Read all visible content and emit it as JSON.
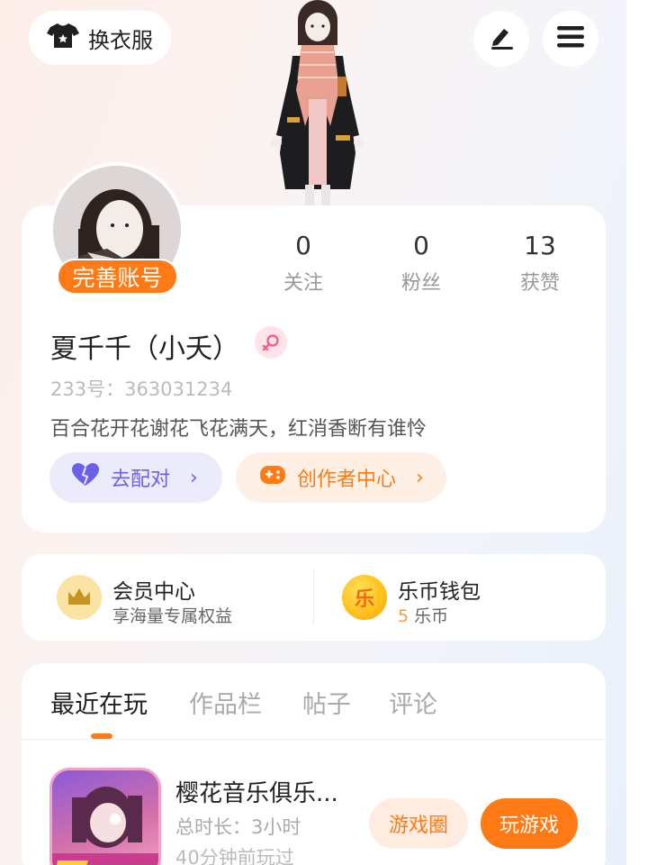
{
  "header": {
    "outfit_label": "换衣服",
    "outfit_icon": "tshirt-icon",
    "edit_icon": "pen-icon",
    "menu_icon": "hamburger-menu-icon"
  },
  "profile": {
    "complete_account_label": "完善账号",
    "stats": [
      {
        "value": "0",
        "label": "关注"
      },
      {
        "value": "0",
        "label": "粉丝"
      },
      {
        "value": "13",
        "label": "获赞"
      }
    ],
    "name": "夏千千（小夭）",
    "gender_icon": "female-icon",
    "uid": "233号：363031234",
    "bio": "百合花开花谢花飞花满天，红消香断有谁怜",
    "match_label": "去配对",
    "creator_label": "创作者中心"
  },
  "member": {
    "vip_title": "会员中心",
    "vip_subtitle": "享海量专属权益",
    "vip_icon": "crown-icon",
    "wallet_title": "乐币钱包",
    "wallet_coins": "5",
    "wallet_unit": "乐币",
    "wallet_icon_char": "乐"
  },
  "tabs": [
    "最近在玩",
    "作品栏",
    "帖子",
    "评论"
  ],
  "game": {
    "title": "樱花音乐俱乐...",
    "duration": "总时长：3小时",
    "last_played": "40分钟前玩过",
    "circle_label": "游戏圈",
    "play_label": "玩游戏"
  },
  "colors": {
    "accent": "#ff7a14",
    "match": "#6b60e8"
  }
}
